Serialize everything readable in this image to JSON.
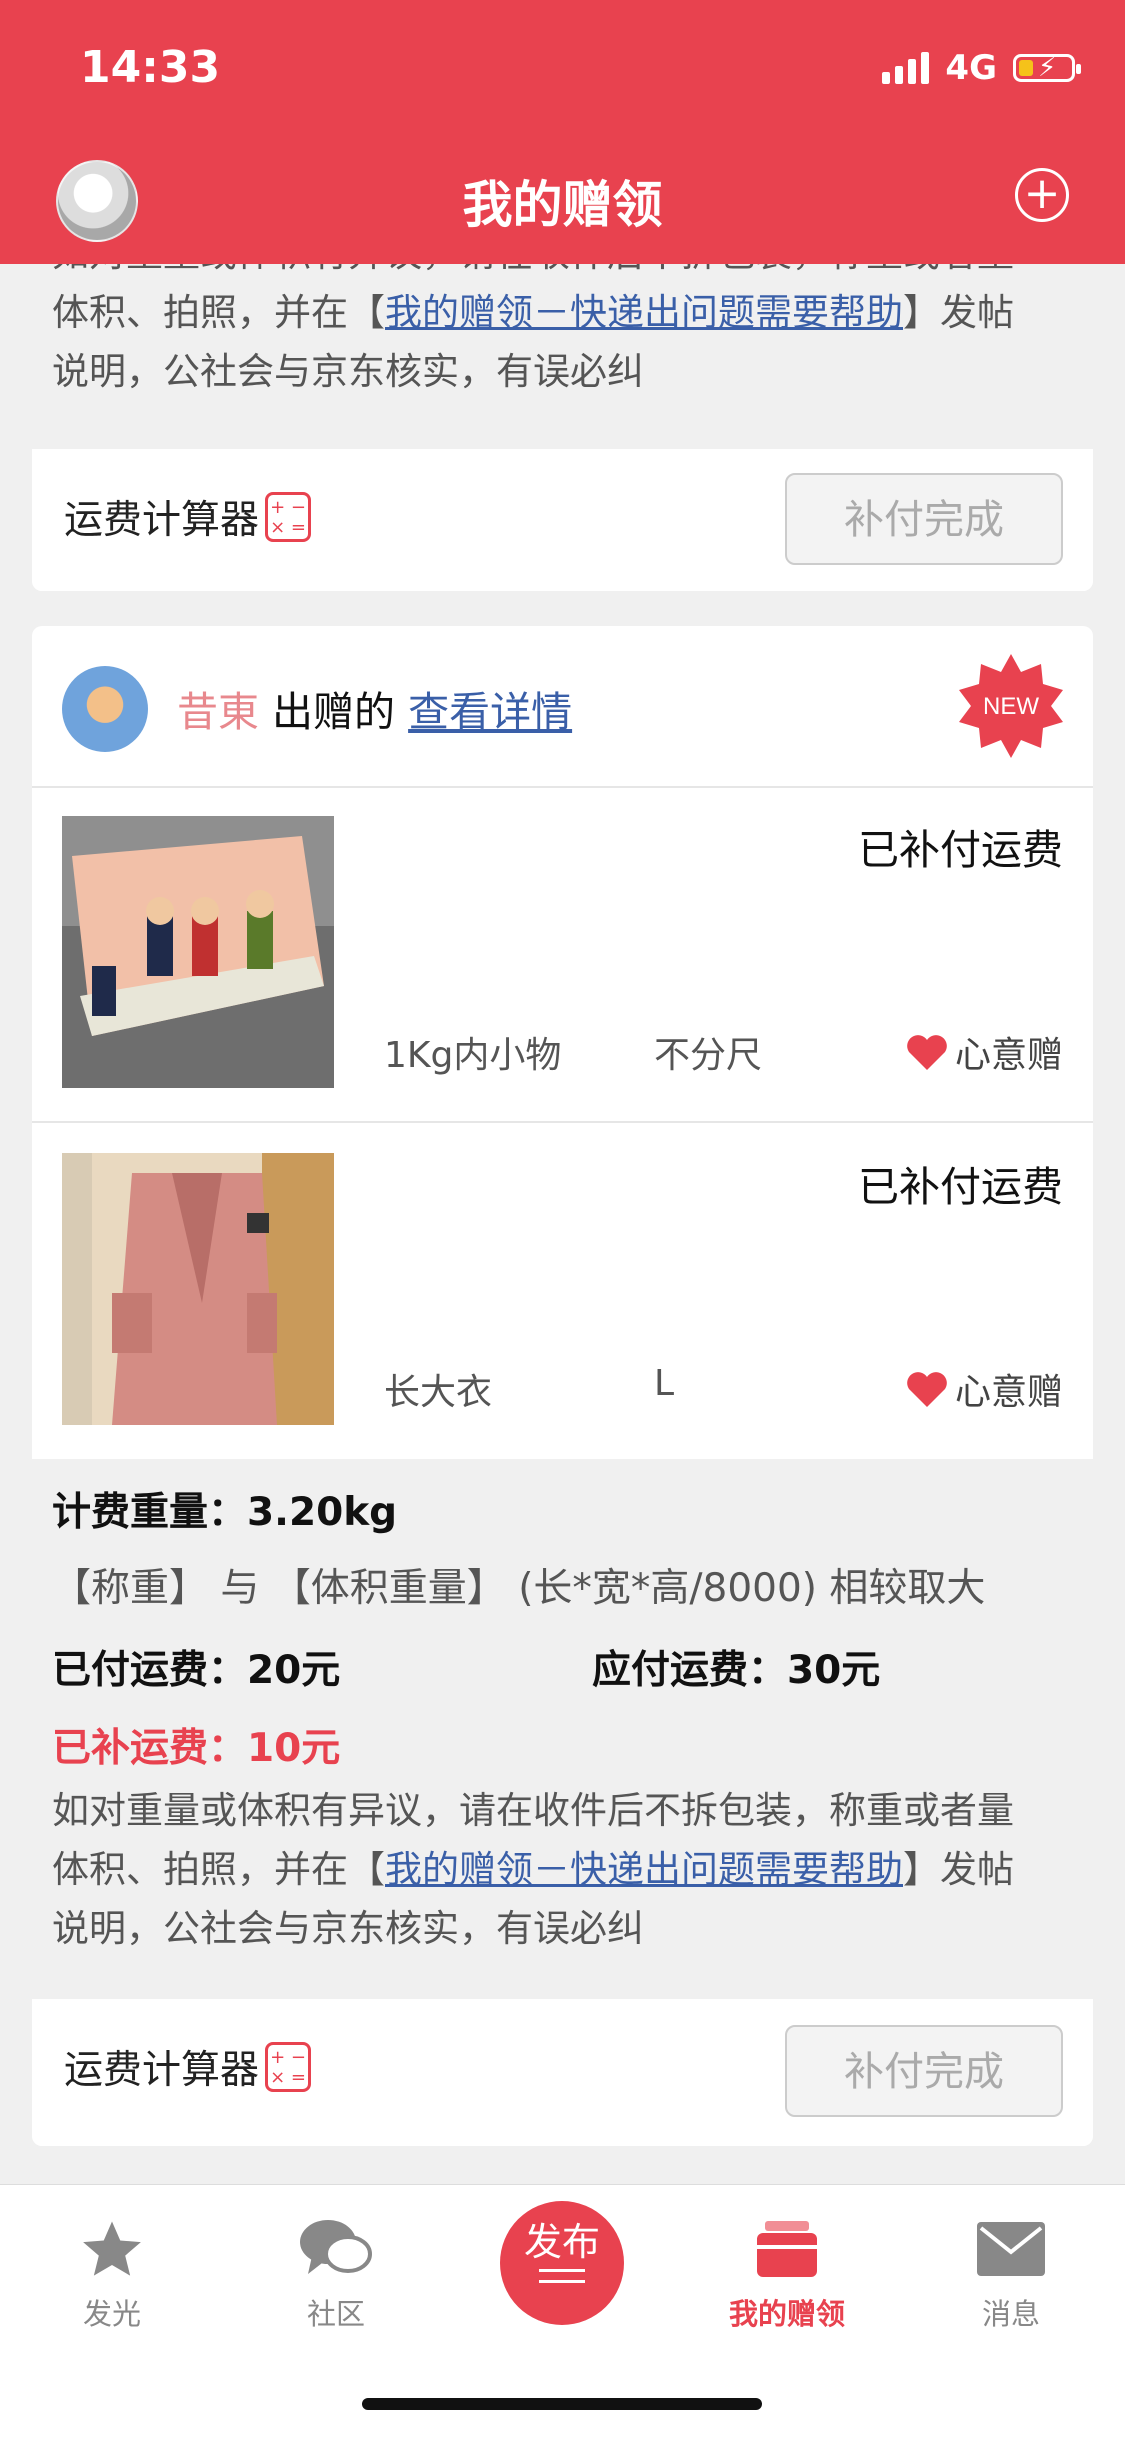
{
  "status_bar": {
    "time": "14:33",
    "network": "4G"
  },
  "header": {
    "title": "我的赠领",
    "add_icon": "plus-circle-icon"
  },
  "top_card": {
    "info_lines": [
      "如对重量或体积有异议，请在收件后不拆包装，称重或者量",
      "体积、拍照，并在【",
      "我的赠领－快递出问题需要帮助",
      "】发帖",
      "说明，公社会与京东核实，有误必纠"
    ],
    "calculator_label": "运费计算器",
    "done_button": "补付完成"
  },
  "giver": {
    "name": "昔東",
    "action": "出赠的",
    "detail_link": "查看详情",
    "badge": "NEW"
  },
  "items": [
    {
      "status": "已补付运费",
      "category": "1Kg内小物",
      "size": "不分尺",
      "tag": "心意赠"
    },
    {
      "status": "已补付运费",
      "category": "长大衣",
      "size": "L",
      "tag": "心意赠"
    }
  ],
  "summary": {
    "weight_label": "计费重量：",
    "weight_value": "3.20kg",
    "rule": "【称重】 与 【体积重量】 (长*宽*高/8000) 相较取大",
    "paid_label": "已付运费：",
    "paid_value": "20元",
    "due_label": "应付运费：",
    "due_value": "30元",
    "extra_label": "已补运费：",
    "extra_value": "10元",
    "info_line1": "如对重量或体积有异议，请在收件后不拆包装，称重或者量",
    "info_line2_pre": "体积、拍照，并在【",
    "info_link": "我的赠领－快递出问题需要帮助",
    "info_line2_post": "】发帖",
    "info_line3": "说明，公社会与京东核实，有误必纠",
    "calculator_label": "运费计算器",
    "done_button": "补付完成"
  },
  "tabbar": {
    "tabs": [
      {
        "label": "发光",
        "icon": "star-icon"
      },
      {
        "label": "社区",
        "icon": "chat-bubbles-icon"
      },
      {
        "label": "发布",
        "icon": "publish-icon"
      },
      {
        "label": "我的赠领",
        "icon": "gift-box-icon"
      },
      {
        "label": "消息",
        "icon": "envelope-icon"
      }
    ],
    "active": "我的赠领"
  },
  "colors": {
    "brand_red": "#e8424f",
    "link_blue": "#3a5fa8",
    "giver_name": "#e8888d"
  }
}
